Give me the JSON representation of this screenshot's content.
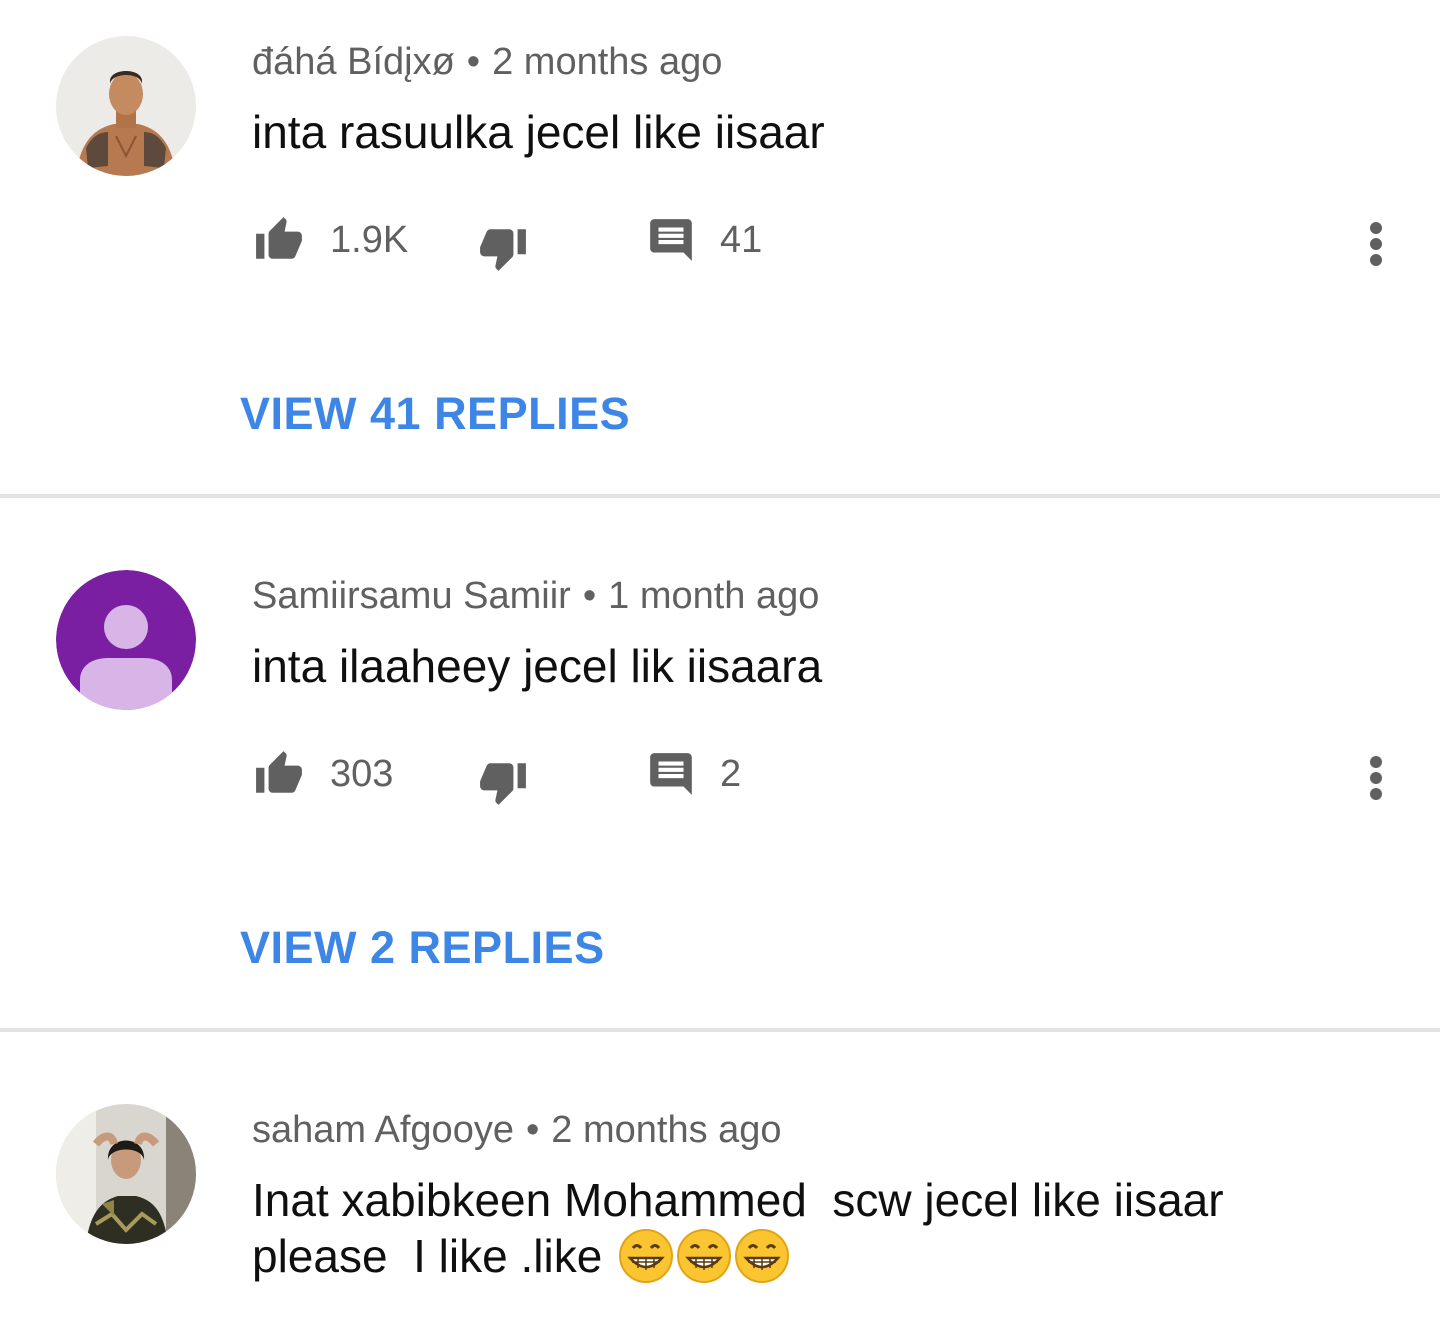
{
  "comments": [
    {
      "author": "đáhá Bídįxø",
      "time": "2 months ago",
      "text": "inta rasuulka jecel like iisaar",
      "likes": "1.9K",
      "replies_count": "41",
      "view_replies": "VIEW 41 REPLIES",
      "avatar": "photo-man-avatar"
    },
    {
      "author": "Samiirsamu Samiir",
      "time": "1 month ago",
      "text": "inta ilaaheey jecel lik iisaara",
      "likes": "303",
      "replies_count": "2",
      "view_replies": "VIEW 2 REPLIES",
      "avatar": "default-person-avatar",
      "avatar_color": "#7b1fa2"
    },
    {
      "author": "saham Afgooye",
      "time": "2 months ago",
      "text_line1": "Inat xabibkeen Mohammed  scw jecel like iisaar",
      "text_line2": "please  I like .like",
      "emoji": "grinning-face-emoji",
      "avatar": "photo-woman-avatar"
    }
  ],
  "separator": "•",
  "colors": {
    "link": "#3e86e6",
    "meta": "#606060",
    "text": "#0f0f0f",
    "divider": "#e3e3e3"
  }
}
